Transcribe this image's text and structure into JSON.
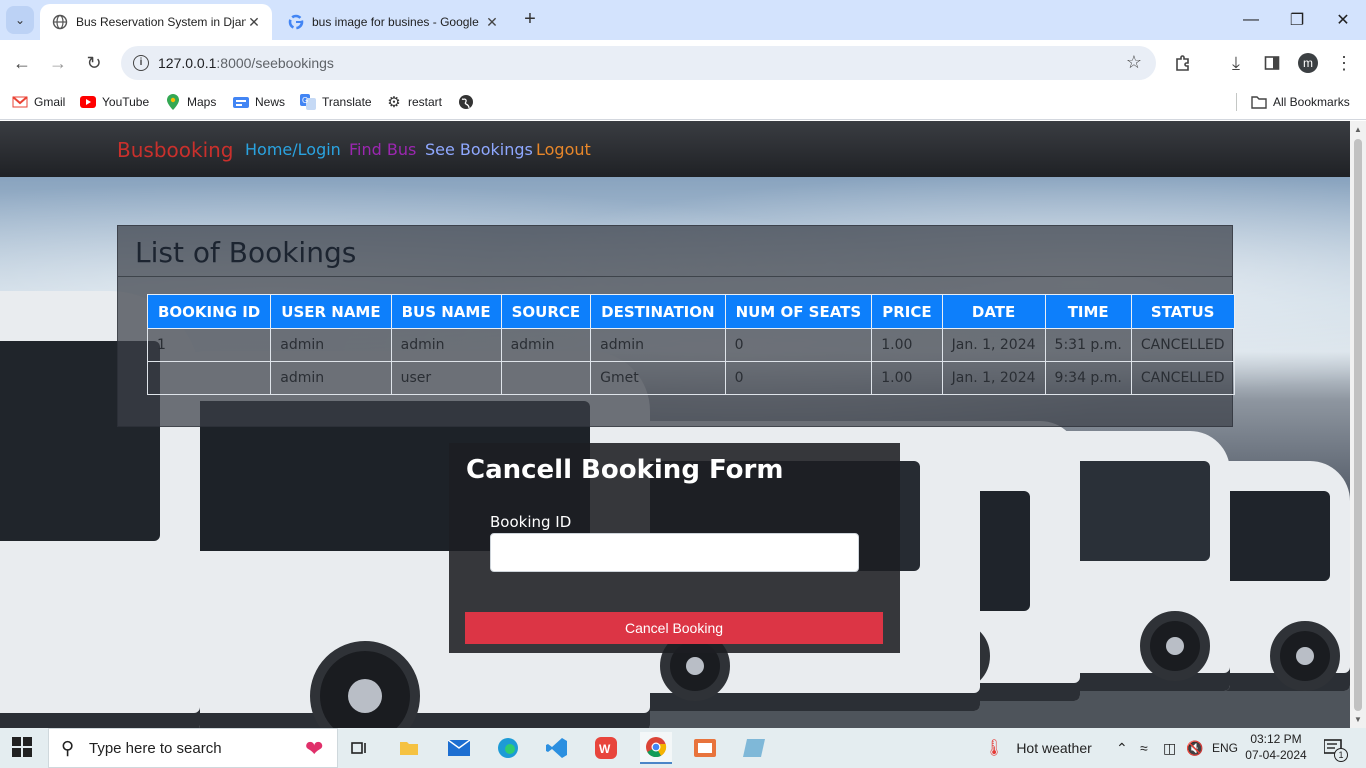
{
  "browser": {
    "tabs": [
      {
        "title": "Bus Reservation System in Djan",
        "active": true
      },
      {
        "title": "bus image for busines - Google",
        "active": false
      }
    ],
    "url_host": "127.0.0.1",
    "url_path": ":8000/seebookings",
    "bookmarks": [
      "Gmail",
      "YouTube",
      "Maps",
      "News",
      "Translate",
      "restart"
    ],
    "all_bookmarks": "All Bookmarks",
    "profile_initial": "m"
  },
  "navbar": {
    "brand": "Busbooking",
    "links": [
      {
        "label": "Home/Login",
        "color": "#2aa3e0"
      },
      {
        "label": "Find Bus",
        "color": "#9b27b0"
      },
      {
        "label": "See Bookings",
        "color": "#8fa8ff"
      },
      {
        "label": "Logout",
        "color": "#e8872a"
      }
    ]
  },
  "bookings": {
    "title": "List of Bookings",
    "headers": [
      "BOOKING ID",
      "USER NAME",
      "BUS NAME",
      "SOURCE",
      "DESTINATION",
      "NUM OF SEATS",
      "PRICE",
      "DATE",
      "TIME",
      "STATUS"
    ],
    "rows": [
      [
        "1",
        "admin",
        "admin",
        "admin",
        "admin",
        "0",
        "1.00",
        "Jan. 1, 2024",
        "5:31 p.m.",
        "CANCELLED"
      ],
      [
        "",
        "admin",
        "user",
        "",
        "Gmet",
        "0",
        "1.00",
        "Jan. 1, 2024",
        "9:34 p.m.",
        "CANCELLED"
      ]
    ]
  },
  "cancel_form": {
    "title": "Cancell Booking Form",
    "label": "Booking ID",
    "input_value": "",
    "button": "Cancel Booking"
  },
  "taskbar": {
    "search_placeholder": "Type here to search",
    "weather": "Hot weather",
    "language": "ENG",
    "time": "03:12 PM",
    "date": "07-04-2024",
    "notifications": "1"
  },
  "colors": {
    "brand": "#c9302c",
    "table_header": "#0d7ffb",
    "cancel_button": "#dc3545"
  }
}
